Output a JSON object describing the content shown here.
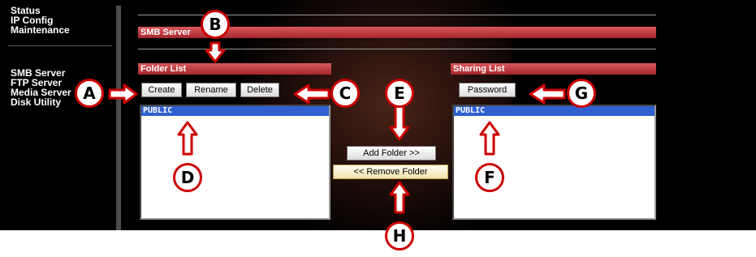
{
  "nav": {
    "items": [
      {
        "label": "Status"
      },
      {
        "label": "IP Config"
      },
      {
        "label": "Maintenance"
      },
      {
        "label": "SMB Server"
      },
      {
        "label": "FTP Server"
      },
      {
        "label": "Media Server"
      },
      {
        "label": "Disk Utility"
      }
    ]
  },
  "main": {
    "section_title": "SMB Server",
    "folder_list": {
      "title": "Folder List",
      "buttons": {
        "create": "Create",
        "rename": "Rename",
        "delete": "Delete"
      },
      "items": [
        "PUBLIC"
      ]
    },
    "sharing_list": {
      "title": "Sharing List",
      "password_button": "Password",
      "items": [
        "PUBLIC"
      ]
    },
    "add_folder_button": "Add Folder >>",
    "remove_folder_button": "<< Remove Folder"
  },
  "callouts": [
    "A",
    "B",
    "C",
    "D",
    "E",
    "F",
    "G",
    "H"
  ],
  "colors": {
    "section_bar_top": "#d8585c",
    "section_bar_bottom": "#a5262c",
    "selected_item": "#3060d0",
    "callout_red": "#cc0000"
  }
}
